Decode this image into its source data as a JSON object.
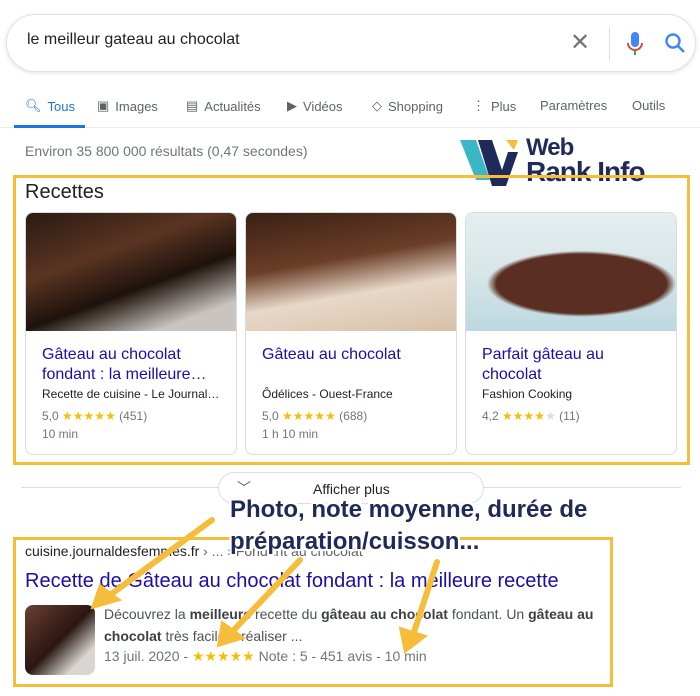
{
  "search": {
    "query": "le meilleur gateau au chocolat"
  },
  "tabs": [
    {
      "label": "Tous",
      "icon": "search-icon"
    },
    {
      "label": "Images",
      "icon": "image-icon"
    },
    {
      "label": "Actualités",
      "icon": "news-icon"
    },
    {
      "label": "Vidéos",
      "icon": "play-icon"
    },
    {
      "label": "Shopping",
      "icon": "tag-icon"
    },
    {
      "label": "Plus",
      "icon": "more-vert-icon"
    },
    {
      "label": "Paramètres"
    },
    {
      "label": "Outils"
    }
  ],
  "stats": "Environ 35 800 000 résultats (0,47 secondes)",
  "logo": {
    "line1": "Web",
    "line2": "Rank Info"
  },
  "recipes": {
    "title": "Recettes",
    "cards": [
      {
        "title": "Gâteau au chocolat fondant : la meilleure…",
        "source": "Recette de cuisine - Le Journal…",
        "rating": "5,0",
        "stars": 5,
        "count": "(451)",
        "duration": "10 min"
      },
      {
        "title": "Gâteau au chocolat",
        "source": "Ôdélices - Ouest-France",
        "rating": "5,0",
        "stars": 5,
        "count": "(688)",
        "duration": "1 h 10 min"
      },
      {
        "title": "Parfait gâteau au chocolat",
        "source": "Fashion Cooking",
        "rating": "4,2",
        "stars": 4,
        "count": "(11)",
        "duration": ""
      }
    ],
    "more": "Afficher plus"
  },
  "result": {
    "crumb_domain": "cuisine.journaldesfemmes.fr",
    "crumb_path": " › ... › Fondant au chocolat",
    "title": "Recette de Gâteau au chocolat fondant : la meilleure recette",
    "snippet": [
      "Découvrez la ",
      "meilleure",
      " recette du ",
      "gâteau au chocolat",
      " fondant. Un ",
      "gâteau au chocolat",
      " très facile à réaliser ..."
    ],
    "date": "13 juil. 2020 - ",
    "stars": 5,
    "meta": " Note : 5 - 451 avis - 10 min"
  },
  "callout": "Photo, note moyenne, durée de préparation/cuisson...",
  "colors": {
    "accent": "#1a73e8",
    "link": "#1a0dab",
    "highlight": "#f5bd3a",
    "star": "#fbbc04"
  }
}
